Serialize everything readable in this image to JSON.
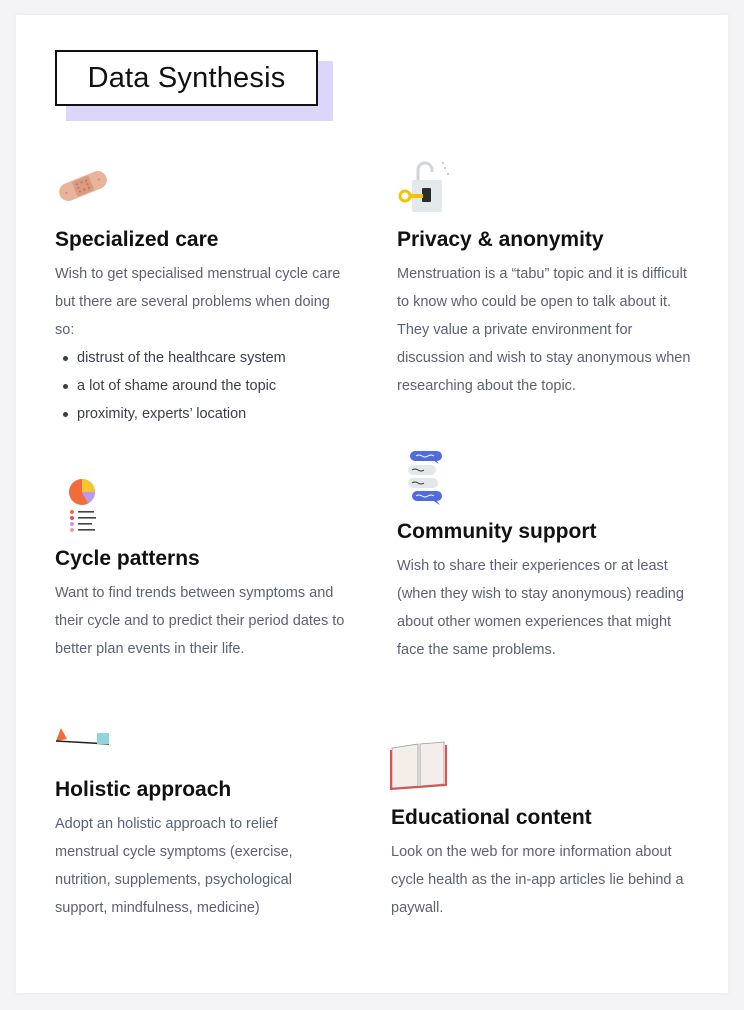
{
  "title": "Data Synthesis",
  "colors": {
    "title_shadow": "#dcd6fb",
    "body_text": "#5b6275",
    "heading_text": "#111111"
  },
  "cards": [
    {
      "icon": "bandage-icon",
      "heading": "Specialized care",
      "text": "Wish to get specialised menstrual cycle care but there are several problems when doing so:",
      "bullets": [
        "distrust of the healthcare system",
        "a lot of shame around the topic",
        "proximity, experts’ location"
      ]
    },
    {
      "icon": "lock-key-icon",
      "heading": "Privacy & anonymity",
      "text": "Menstruation is a “tabu” topic and it is difficult to know who could be open to talk about it. They value a private environment for discussion and wish to stay anonymous when researching about the topic."
    },
    {
      "icon": "pie-chart-list-icon",
      "heading": "Cycle patterns",
      "text": "Want to find trends between symptoms and their cycle and to predict their period dates to better plan events in their life."
    },
    {
      "icon": "chat-bubbles-icon",
      "heading": "Community support",
      "text": "Wish to share their experiences or at least (when they wish to stay anonymous) reading about other women experiences that might face the same problems."
    },
    {
      "icon": "balance-icon",
      "heading": "Holistic approach",
      "text": "Adopt an holistic approach to relief menstrual cycle symptoms (exercise, nutrition, supplements, psychological support, mindfulness, medicine)"
    },
    {
      "icon": "open-book-icon",
      "heading": "Educational content",
      "text": "Look on the web for more information about cycle health as the in-app articles lie behind a paywall."
    }
  ]
}
